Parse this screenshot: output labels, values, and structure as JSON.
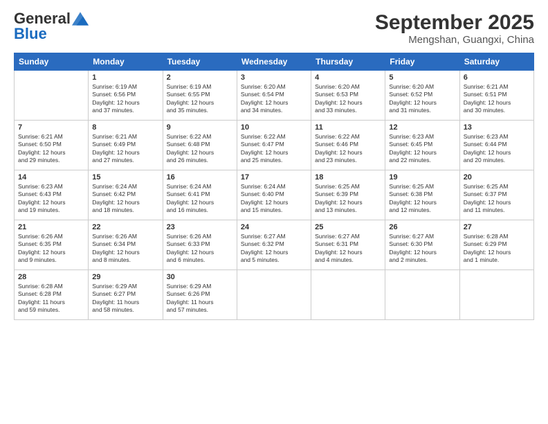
{
  "header": {
    "logo_general": "General",
    "logo_blue": "Blue",
    "month_title": "September 2025",
    "location": "Mengshan, Guangxi, China"
  },
  "days_of_week": [
    "Sunday",
    "Monday",
    "Tuesday",
    "Wednesday",
    "Thursday",
    "Friday",
    "Saturday"
  ],
  "weeks": [
    [
      {
        "day": "",
        "info": ""
      },
      {
        "day": "1",
        "info": "Sunrise: 6:19 AM\nSunset: 6:56 PM\nDaylight: 12 hours\nand 37 minutes."
      },
      {
        "day": "2",
        "info": "Sunrise: 6:19 AM\nSunset: 6:55 PM\nDaylight: 12 hours\nand 35 minutes."
      },
      {
        "day": "3",
        "info": "Sunrise: 6:20 AM\nSunset: 6:54 PM\nDaylight: 12 hours\nand 34 minutes."
      },
      {
        "day": "4",
        "info": "Sunrise: 6:20 AM\nSunset: 6:53 PM\nDaylight: 12 hours\nand 33 minutes."
      },
      {
        "day": "5",
        "info": "Sunrise: 6:20 AM\nSunset: 6:52 PM\nDaylight: 12 hours\nand 31 minutes."
      },
      {
        "day": "6",
        "info": "Sunrise: 6:21 AM\nSunset: 6:51 PM\nDaylight: 12 hours\nand 30 minutes."
      }
    ],
    [
      {
        "day": "7",
        "info": "Sunrise: 6:21 AM\nSunset: 6:50 PM\nDaylight: 12 hours\nand 29 minutes."
      },
      {
        "day": "8",
        "info": "Sunrise: 6:21 AM\nSunset: 6:49 PM\nDaylight: 12 hours\nand 27 minutes."
      },
      {
        "day": "9",
        "info": "Sunrise: 6:22 AM\nSunset: 6:48 PM\nDaylight: 12 hours\nand 26 minutes."
      },
      {
        "day": "10",
        "info": "Sunrise: 6:22 AM\nSunset: 6:47 PM\nDaylight: 12 hours\nand 25 minutes."
      },
      {
        "day": "11",
        "info": "Sunrise: 6:22 AM\nSunset: 6:46 PM\nDaylight: 12 hours\nand 23 minutes."
      },
      {
        "day": "12",
        "info": "Sunrise: 6:23 AM\nSunset: 6:45 PM\nDaylight: 12 hours\nand 22 minutes."
      },
      {
        "day": "13",
        "info": "Sunrise: 6:23 AM\nSunset: 6:44 PM\nDaylight: 12 hours\nand 20 minutes."
      }
    ],
    [
      {
        "day": "14",
        "info": "Sunrise: 6:23 AM\nSunset: 6:43 PM\nDaylight: 12 hours\nand 19 minutes."
      },
      {
        "day": "15",
        "info": "Sunrise: 6:24 AM\nSunset: 6:42 PM\nDaylight: 12 hours\nand 18 minutes."
      },
      {
        "day": "16",
        "info": "Sunrise: 6:24 AM\nSunset: 6:41 PM\nDaylight: 12 hours\nand 16 minutes."
      },
      {
        "day": "17",
        "info": "Sunrise: 6:24 AM\nSunset: 6:40 PM\nDaylight: 12 hours\nand 15 minutes."
      },
      {
        "day": "18",
        "info": "Sunrise: 6:25 AM\nSunset: 6:39 PM\nDaylight: 12 hours\nand 13 minutes."
      },
      {
        "day": "19",
        "info": "Sunrise: 6:25 AM\nSunset: 6:38 PM\nDaylight: 12 hours\nand 12 minutes."
      },
      {
        "day": "20",
        "info": "Sunrise: 6:25 AM\nSunset: 6:37 PM\nDaylight: 12 hours\nand 11 minutes."
      }
    ],
    [
      {
        "day": "21",
        "info": "Sunrise: 6:26 AM\nSunset: 6:35 PM\nDaylight: 12 hours\nand 9 minutes."
      },
      {
        "day": "22",
        "info": "Sunrise: 6:26 AM\nSunset: 6:34 PM\nDaylight: 12 hours\nand 8 minutes."
      },
      {
        "day": "23",
        "info": "Sunrise: 6:26 AM\nSunset: 6:33 PM\nDaylight: 12 hours\nand 6 minutes."
      },
      {
        "day": "24",
        "info": "Sunrise: 6:27 AM\nSunset: 6:32 PM\nDaylight: 12 hours\nand 5 minutes."
      },
      {
        "day": "25",
        "info": "Sunrise: 6:27 AM\nSunset: 6:31 PM\nDaylight: 12 hours\nand 4 minutes."
      },
      {
        "day": "26",
        "info": "Sunrise: 6:27 AM\nSunset: 6:30 PM\nDaylight: 12 hours\nand 2 minutes."
      },
      {
        "day": "27",
        "info": "Sunrise: 6:28 AM\nSunset: 6:29 PM\nDaylight: 12 hours\nand 1 minute."
      }
    ],
    [
      {
        "day": "28",
        "info": "Sunrise: 6:28 AM\nSunset: 6:28 PM\nDaylight: 11 hours\nand 59 minutes."
      },
      {
        "day": "29",
        "info": "Sunrise: 6:29 AM\nSunset: 6:27 PM\nDaylight: 11 hours\nand 58 minutes."
      },
      {
        "day": "30",
        "info": "Sunrise: 6:29 AM\nSunset: 6:26 PM\nDaylight: 11 hours\nand 57 minutes."
      },
      {
        "day": "",
        "info": ""
      },
      {
        "day": "",
        "info": ""
      },
      {
        "day": "",
        "info": ""
      },
      {
        "day": "",
        "info": ""
      }
    ]
  ]
}
